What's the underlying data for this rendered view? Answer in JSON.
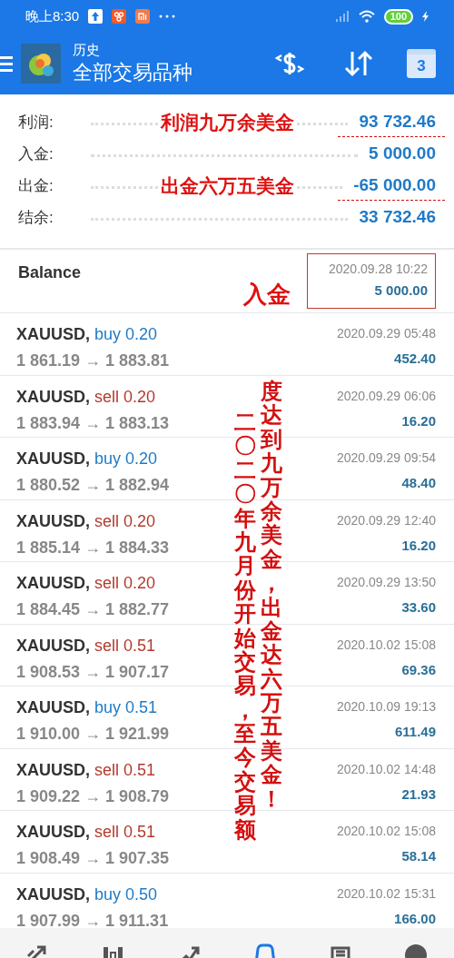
{
  "status_bar": {
    "time": "晚上8:30",
    "battery": "100"
  },
  "header": {
    "subtitle": "历史",
    "title": "全部交易品种",
    "calendar_day": "3"
  },
  "summary": [
    {
      "label": "利润:",
      "value": "93 732.46",
      "note": "利润九万余美金",
      "underlined": true
    },
    {
      "label": "入金:",
      "value": "5 000.00",
      "underlined": false
    },
    {
      "label": "出金:",
      "value": "-65 000.00",
      "note": "出金六万五美金",
      "underlined": true
    },
    {
      "label": "结余:",
      "value": "33 732.46",
      "underlined": false
    }
  ],
  "balance": {
    "title": "Balance",
    "time": "2020.09.28 10:22",
    "amount": "5 000.00",
    "note": "入金",
    "boxed": true
  },
  "trades": [
    {
      "symbol": "XAUUSD,",
      "side": "buy",
      "volume": "0.20",
      "prices": "1 861.19 → 1 883.81",
      "time": "2020.09.29 05:48",
      "profit": "452.40"
    },
    {
      "symbol": "XAUUSD,",
      "side": "sell",
      "volume": "0.20",
      "prices": "1 883.94 → 1 883.13",
      "time": "2020.09.29 06:06",
      "profit": "16.20"
    },
    {
      "symbol": "XAUUSD,",
      "side": "buy",
      "volume": "0.20",
      "prices": "1 880.52 → 1 882.94",
      "time": "2020.09.29 09:54",
      "profit": "48.40"
    },
    {
      "symbol": "XAUUSD,",
      "side": "sell",
      "volume": "0.20",
      "prices": "1 885.14 → 1 884.33",
      "time": "2020.09.29 12:40",
      "profit": "16.20"
    },
    {
      "symbol": "XAUUSD,",
      "side": "sell",
      "volume": "0.20",
      "prices": "1 884.45 → 1 882.77",
      "time": "2020.09.29 13:50",
      "profit": "33.60"
    },
    {
      "symbol": "XAUUSD,",
      "side": "sell",
      "volume": "0.51",
      "prices": "1 908.53 → 1 907.17",
      "time": "2020.10.02 15:08",
      "profit": "69.36"
    },
    {
      "symbol": "XAUUSD,",
      "side": "buy",
      "volume": "0.51",
      "prices": "1 910.00 → 1 921.99",
      "time": "2020.10.09 19:13",
      "profit": "611.49"
    },
    {
      "symbol": "XAUUSD,",
      "side": "sell",
      "volume": "0.51",
      "prices": "1 909.22 → 1 908.79",
      "time": "2020.10.02 14:48",
      "profit": "21.93"
    },
    {
      "symbol": "XAUUSD,",
      "side": "sell",
      "volume": "0.51",
      "prices": "1 908.49 → 1 907.35",
      "time": "2020.10.02 15:08",
      "profit": "58.14"
    },
    {
      "symbol": "XAUUSD,",
      "side": "buy",
      "volume": "0.50",
      "prices": "1 907.99 → 1 911.31",
      "time": "2020.10.02 15:31",
      "profit": "166.00"
    }
  ],
  "vertical_note": [
    "二〇二〇年九月份开始交易，至今交易额",
    "度达到九万余美金，出金达六万五美金！"
  ],
  "bottom_nav": [
    {
      "selected": false
    },
    {
      "selected": false
    },
    {
      "selected": false
    },
    {
      "selected": true
    },
    {
      "selected": false
    },
    {
      "selected": false
    }
  ]
}
